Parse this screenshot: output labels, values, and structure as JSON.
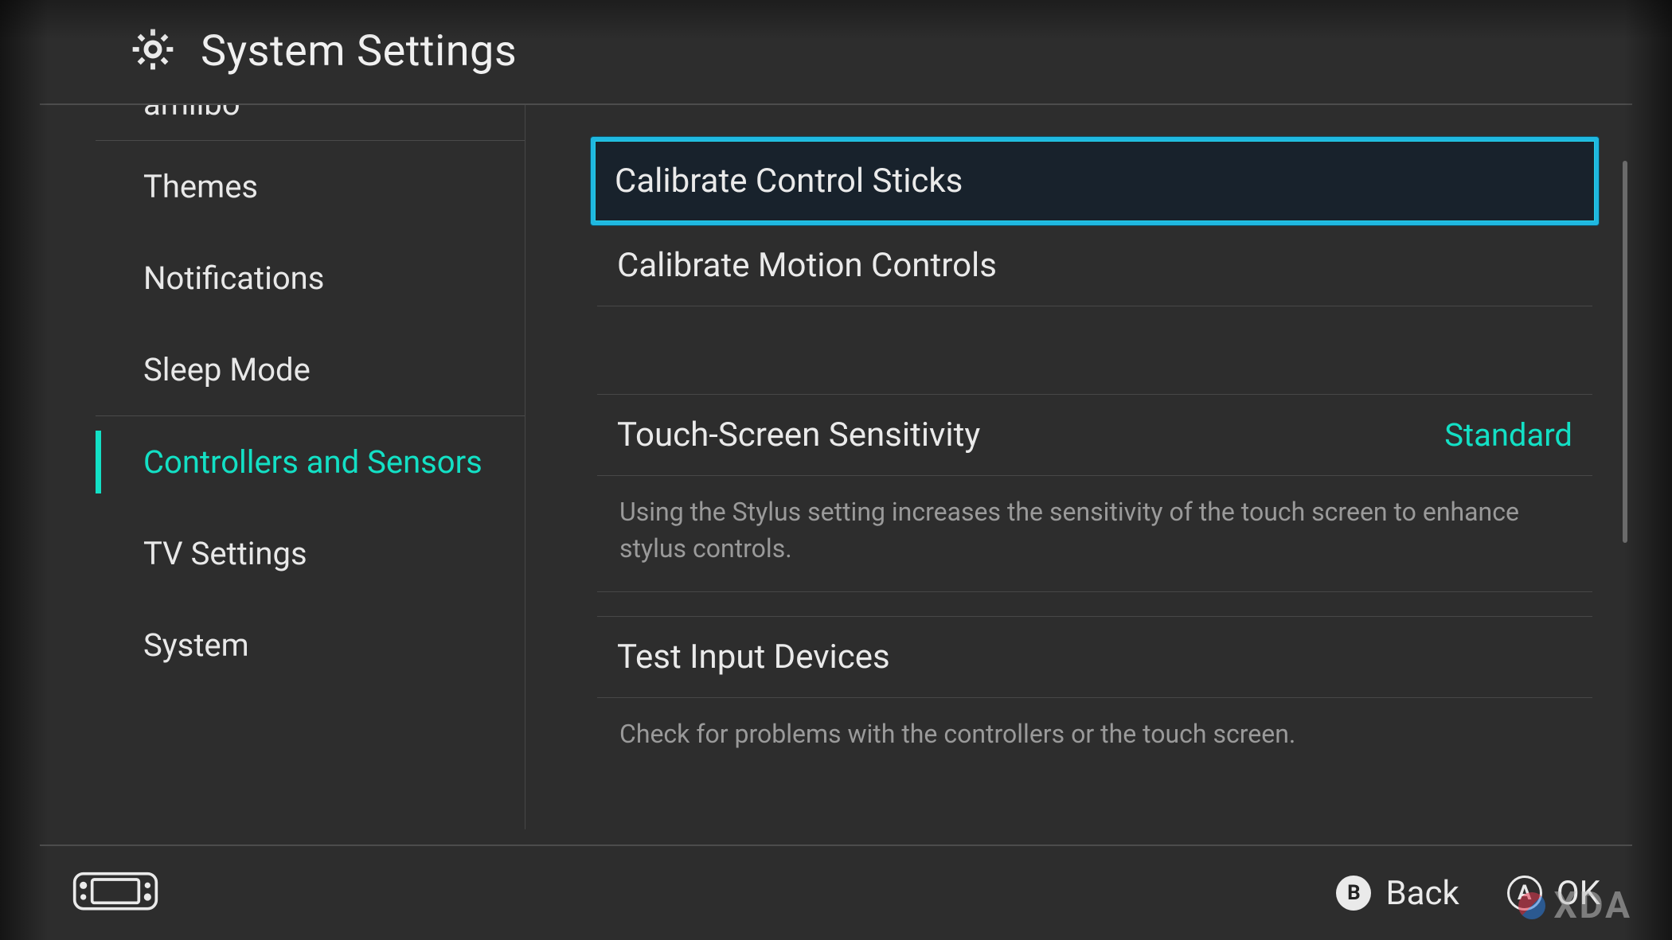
{
  "header": {
    "title": "System Settings"
  },
  "sidebar": {
    "partial_top": "amiibo",
    "items": [
      {
        "label": "Themes",
        "active": false
      },
      {
        "label": "Notifications",
        "active": false
      },
      {
        "label": "Sleep Mode",
        "active": false
      },
      {
        "label": "Controllers and Sensors",
        "active": true
      },
      {
        "label": "TV Settings",
        "active": false
      },
      {
        "label": "System",
        "active": false
      }
    ]
  },
  "content": {
    "calibrate_sticks": "Calibrate Control Sticks",
    "calibrate_motion": "Calibrate Motion Controls",
    "touch_sensitivity": {
      "label": "Touch-Screen Sensitivity",
      "value": "Standard"
    },
    "touch_desc": "Using the Stylus setting increases the sensitivity of the touch screen to enhance stylus controls.",
    "test_input": "Test Input Devices",
    "test_input_desc": "Check for problems with the controllers or the touch screen."
  },
  "footer": {
    "b": {
      "glyph": "B",
      "label": "Back"
    },
    "a": {
      "glyph": "A",
      "label": "OK"
    }
  },
  "watermark": "XDA"
}
